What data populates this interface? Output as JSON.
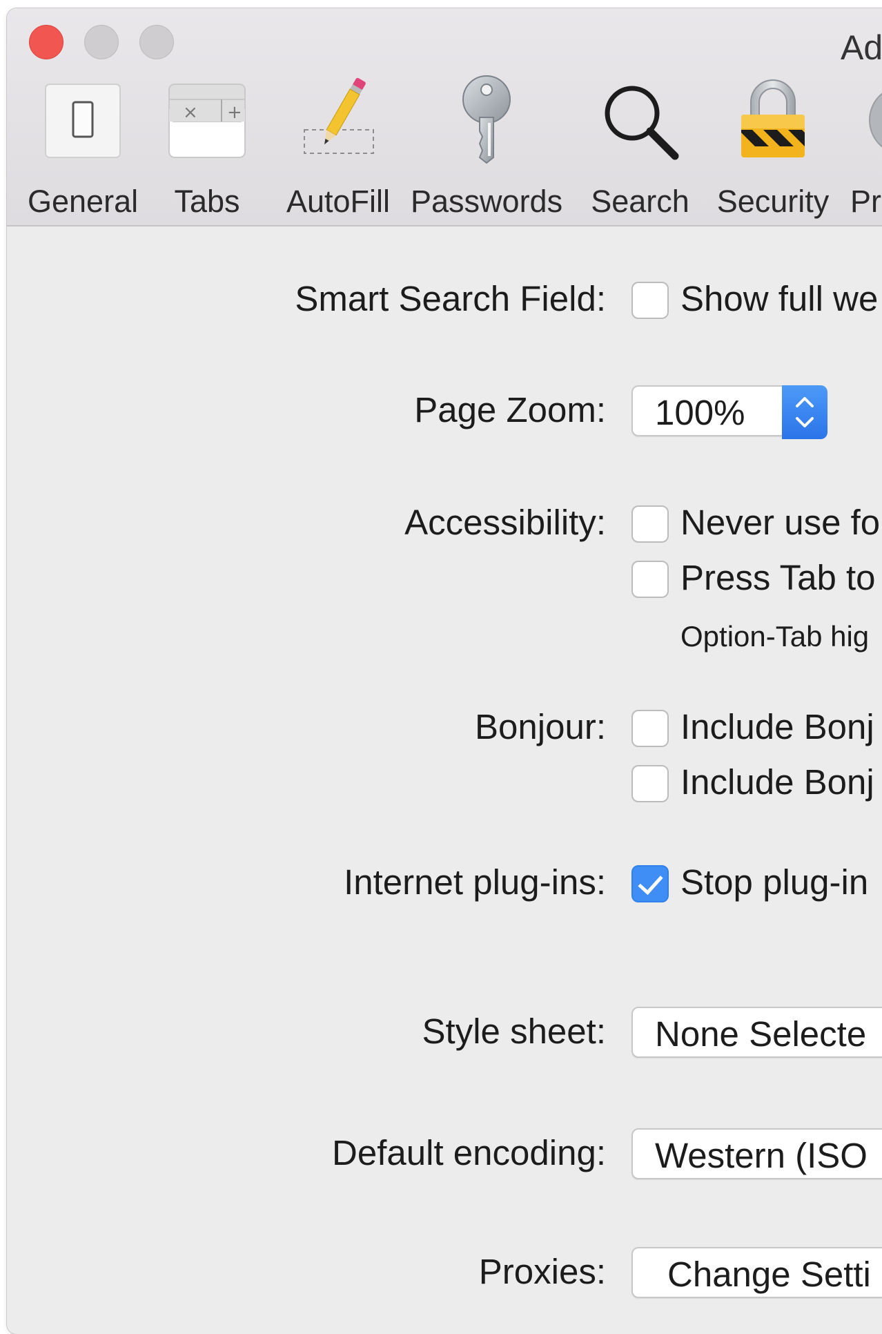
{
  "window": {
    "title": "Ad"
  },
  "toolbar": {
    "items": [
      {
        "label": "General",
        "icon": "switch-icon"
      },
      {
        "label": "Tabs",
        "icon": "tabs-icon"
      },
      {
        "label": "AutoFill",
        "icon": "pencil-icon"
      },
      {
        "label": "Passwords",
        "icon": "key-icon"
      },
      {
        "label": "Search",
        "icon": "magnifier-icon"
      },
      {
        "label": "Security",
        "icon": "lock-icon"
      },
      {
        "label": "Pr",
        "icon": "privacy-icon"
      }
    ]
  },
  "settings": {
    "smart_search": {
      "label": "Smart Search Field:",
      "option": "Show full we",
      "checked": false
    },
    "page_zoom": {
      "label": "Page Zoom:",
      "value": "100%"
    },
    "accessibility": {
      "label": "Accessibility:",
      "option1": "Never use fo",
      "option2": "Press Tab to",
      "hint": "Option-Tab hig"
    },
    "bonjour": {
      "label": "Bonjour:",
      "option1": "Include Bonj",
      "option2": "Include Bonj"
    },
    "plugins": {
      "label": "Internet plug-ins:",
      "option": "Stop plug-in",
      "checked": true
    },
    "style_sheet": {
      "label": "Style sheet:",
      "value": "None Selecte"
    },
    "encoding": {
      "label": "Default encoding:",
      "value": "Western (ISO"
    },
    "proxies": {
      "label": "Proxies:",
      "value": "Change Setti"
    }
  },
  "colors": {
    "close": "#f25650",
    "accent": "#3f8ef6",
    "window_bg": "#ececec"
  }
}
